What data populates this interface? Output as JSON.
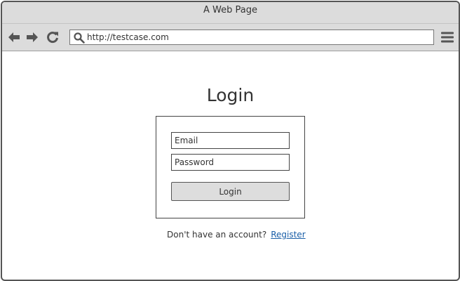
{
  "window": {
    "title": "A Web Page"
  },
  "toolbar": {
    "back_icon": "arrow-left-icon",
    "forward_icon": "arrow-right-icon",
    "reload_icon": "reload-icon",
    "search_icon": "search-icon",
    "menu_icon": "hamburger-menu-icon",
    "url": "http://testcase.com"
  },
  "login": {
    "title": "Login",
    "email_placeholder": "Email",
    "password_placeholder": "Password",
    "button_label": "Login",
    "no_account_text": "Don't have an account?",
    "register_label": "Register"
  },
  "colors": {
    "chrome_background": "#dcdcdc",
    "button_background": "#dddddd",
    "link": "#1a5fa8",
    "text": "#333333",
    "icon": "#555555"
  }
}
